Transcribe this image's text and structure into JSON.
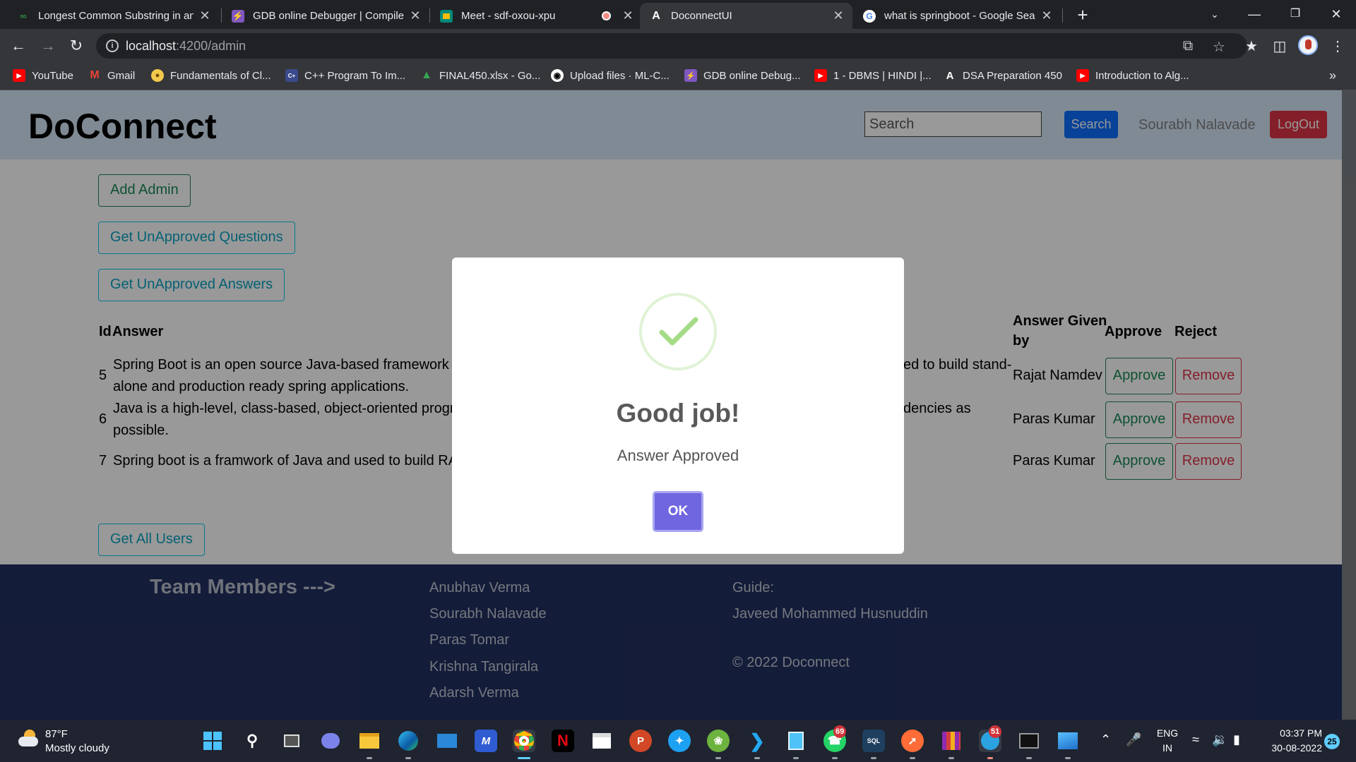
{
  "browser": {
    "tabs": [
      {
        "title": "Longest Common Substring in an",
        "icon": "gfg-icon",
        "active": false
      },
      {
        "title": "GDB online Debugger | Compiler",
        "icon": "gdb-icon",
        "active": false
      },
      {
        "title": "Meet - sdf-oxou-xpu",
        "icon": "meet-icon",
        "active": false
      },
      {
        "title": "DoconnectUI",
        "icon": "angular-icon",
        "active": true
      },
      {
        "title": "what is springboot - Google Sear",
        "icon": "google-icon",
        "active": false
      }
    ],
    "url_host": "localhost",
    "url_path": ":4200/admin",
    "bookmarks": [
      {
        "label": "YouTube",
        "icon": "youtube-icon",
        "color": "#ff0000"
      },
      {
        "label": "Gmail",
        "icon": "gmail-icon",
        "color": "#ea4335"
      },
      {
        "label": "Fundamentals of Cl...",
        "icon": "coursera-icon",
        "color": "#f2c94c"
      },
      {
        "label": "C++ Program To Im...",
        "icon": "site-icon",
        "color": "#3b4a8c"
      },
      {
        "label": "FINAL450.xlsx - Go...",
        "icon": "drive-icon",
        "color": "#34a853"
      },
      {
        "label": "Upload files · ML-C...",
        "icon": "github-icon",
        "color": "#ffffff"
      },
      {
        "label": "GDB online Debug...",
        "icon": "gdb-icon",
        "color": "#7e57c2"
      },
      {
        "label": "1 - DBMS | HINDI |...",
        "icon": "youtube-icon",
        "color": "#ff0000"
      },
      {
        "label": "DSA Preparation 450",
        "icon": "angular-icon",
        "color": "#ffffff"
      },
      {
        "label": "Introduction to Alg...",
        "icon": "youtube-icon",
        "color": "#ff0000"
      }
    ]
  },
  "app": {
    "brand": "DoConnect",
    "search_placeholder": "Search",
    "search_button": "Search",
    "user_name": "Sourabh Nalavade",
    "logout_button": "LogOut",
    "buttons": {
      "add_admin": "Add Admin",
      "unapproved_questions": "Get UnApproved Questions",
      "unapproved_answers": "Get UnApproved Answers",
      "all_users": "Get All Users"
    },
    "table": {
      "headers": {
        "id": "Id",
        "answer": "Answer",
        "given_by_line1": "Answer Given",
        "given_by_line2": "by",
        "approve": "Approve",
        "reject": "Reject"
      },
      "rows": [
        {
          "id": "5",
          "answer_l1": "Spring Boot is an open source Java-based framework",
          "answer_r1": "ed to build stand-",
          "answer_l2": "alone and production ready spring applications.",
          "given_by": "Rajat Namdev",
          "approve": "Approve",
          "reject": "Remove"
        },
        {
          "id": "6",
          "answer_l1": "Java is a high-level, class-based, object-oriented progra",
          "answer_r1": "dencies as",
          "answer_l2": "possible.",
          "given_by": "Paras Kumar",
          "approve": "Approve",
          "reject": "Remove"
        },
        {
          "id": "7",
          "answer_l1": "Spring boot is a framwork of Java and used to build RA",
          "answer_r1": "",
          "answer_l2": "",
          "given_by": "Paras Kumar",
          "approve": "Approve",
          "reject": "Remove"
        }
      ]
    },
    "footer": {
      "team_title": "Team Members --->",
      "members": [
        "Anubhav Verma",
        "Sourabh Nalavade",
        "Paras Tomar",
        "Krishna Tangirala",
        "Adarsh Verma"
      ],
      "guide_label": "Guide:",
      "guide_name": "Javeed Mohammed Husnuddin",
      "copyright": "© 2022 Doconnect"
    }
  },
  "modal": {
    "title": "Good job!",
    "text": "Answer Approved",
    "ok_button": "OK",
    "icon": "success-check-icon",
    "accent": "#a5dc86"
  },
  "taskbar": {
    "weather_temp": "87°F",
    "weather_desc": "Mostly cloudy",
    "whatsapp_badge": "69",
    "telegram_badge": "51",
    "lang_top": "ENG",
    "lang_bottom": "IN",
    "time": "03:37 PM",
    "date": "30-08-2022",
    "notifications": "25"
  },
  "colors": {
    "primary": "#0d6efd",
    "danger": "#dc3545",
    "success": "#198754",
    "info": "#0dcaf0",
    "footer_bg": "#212f5f",
    "header_bg": "#d6e6f7",
    "swal_confirm": "#7066e0"
  }
}
